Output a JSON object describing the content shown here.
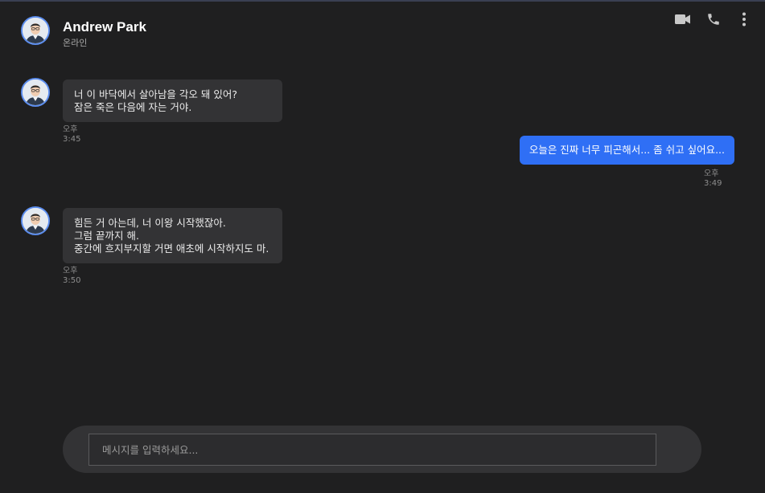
{
  "header": {
    "contact_name": "Andrew Park",
    "contact_status": "온라인",
    "actions": [
      "video-call-icon",
      "phone-icon",
      "more-vert-icon"
    ]
  },
  "messages": [
    {
      "direction": "incoming",
      "text": "너 이 바닥에서 살아남을 각오 돼 있어?\n잠은 죽은 다음에 자는 거야.",
      "time_period": "오후",
      "time": "3:45"
    },
    {
      "direction": "outgoing",
      "text": "오늘은 진짜 너무 피곤해서... 좀 쉬고 싶어요...",
      "time_period": "오후",
      "time": "3:49"
    },
    {
      "direction": "incoming",
      "text": "힘든 거 아는데, 너 이왕 시작했잖아.\n그럼 끝까지 해.\n중간에 흐지부지할 거면 애초에 시작하지도 마.",
      "time_period": "오후",
      "time": "3:50"
    }
  ],
  "composer": {
    "placeholder": "메시지를 입력하세요...",
    "value": ""
  },
  "colors": {
    "background": "#1f1f20",
    "incoming_bubble": "#333335",
    "outgoing_bubble": "#2f6ff5",
    "avatar_ring": "#5b8def"
  }
}
